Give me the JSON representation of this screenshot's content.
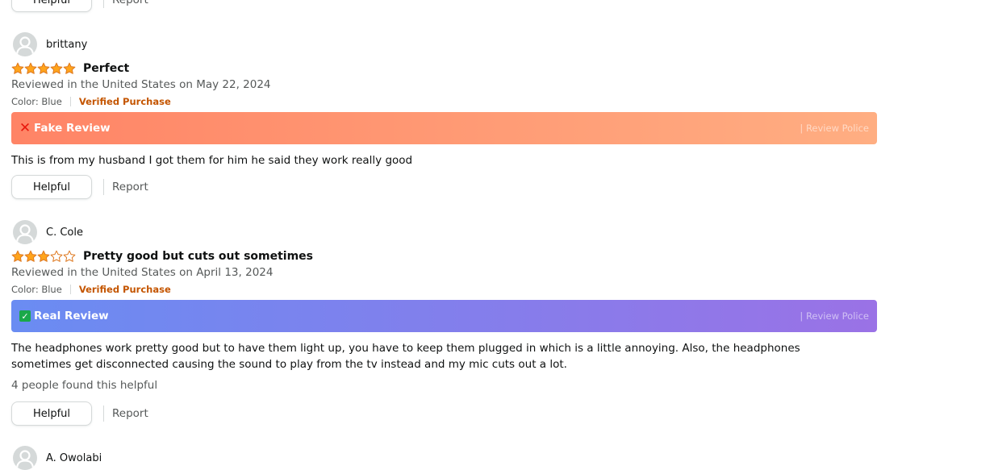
{
  "top_actions": {
    "helpful_label": "Helpful",
    "report_label": "Report"
  },
  "reviews": [
    {
      "user": "brittany",
      "stars": 5,
      "title": "Perfect",
      "date_text": "Reviewed in the United States on May 22, 2024",
      "variant": "Color: Blue",
      "verified": "Verified Purchase",
      "verdict_icon": "x-mark-icon",
      "verdict": "Fake Review",
      "verdict_type": "fake",
      "brand": "| Review Police",
      "body": "This is from my husband I got them for him he said they work really good",
      "helpful_count": "",
      "helpful_label": "Helpful",
      "report_label": "Report"
    },
    {
      "user": "C. Cole",
      "stars": 3,
      "title": "Pretty good but cuts out sometimes",
      "date_text": "Reviewed in the United States on April 13, 2024",
      "variant": "Color: Blue",
      "verified": "Verified Purchase",
      "verdict_icon": "check-box-icon",
      "verdict": "Real Review",
      "verdict_type": "real",
      "brand": "| Review Police",
      "body": "The headphones work pretty good but to have them light up, you have to keep them plugged in which is a little annoying. Also, the headphones sometimes get disconnected causing the sound to play from the tv instead and my mic cuts out a lot.",
      "helpful_count": "4 people found this helpful",
      "helpful_label": "Helpful",
      "report_label": "Report"
    },
    {
      "user": "A. Owolabi"
    }
  ],
  "colors": {
    "star_fill": "#ffa41c",
    "star_outline": "#de7921",
    "verified": "#c45500",
    "fake_gradient": [
      "#ff8466",
      "#ffae82"
    ],
    "real_gradient": [
      "#6a8cf2",
      "#9a72e6"
    ]
  }
}
